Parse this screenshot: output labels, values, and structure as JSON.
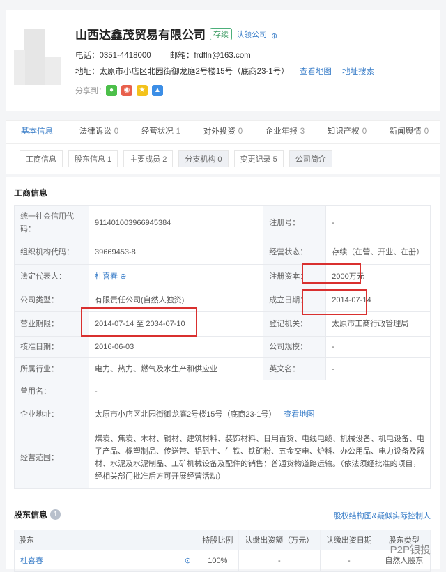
{
  "company": {
    "name": "山西达鑫茂贸易有限公司",
    "status": "存续",
    "claim": "认领公司",
    "phone": "电话：0351-4418000",
    "email": "邮箱：frdfln@163.com",
    "address": "地址：太原市小店区北园街御龙庭2号楼15号（底商23-1号）",
    "view_map": "查看地图",
    "addr_search": "地址搜索",
    "share_label": "分享到："
  },
  "tabs": [
    {
      "label": "基本信息",
      "count": ""
    },
    {
      "label": "法律诉讼",
      "count": "0"
    },
    {
      "label": "经营状况",
      "count": "1"
    },
    {
      "label": "对外投资",
      "count": "0"
    },
    {
      "label": "企业年报",
      "count": "3"
    },
    {
      "label": "知识产权",
      "count": "0"
    },
    {
      "label": "新闻舆情",
      "count": "0"
    }
  ],
  "subtabs": [
    "工商信息",
    "股东信息 1",
    "主要成员 2",
    "分支机构 0",
    "变更记录 5",
    "公司简介"
  ],
  "section_title": "工商信息",
  "info": {
    "credit_code_label": "统一社会信用代码：",
    "credit_code": "911401003966945384",
    "reg_no_label": "注册号：",
    "reg_no": "-",
    "org_code_label": "组织机构代码：",
    "org_code": "39669453-8",
    "biz_status_label": "经营状态：",
    "biz_status": "存续（在营、开业、在册）",
    "legal_rep_label": "法定代表人：",
    "legal_rep": "杜喜春",
    "reg_capital_label": "注册资本：",
    "reg_capital": "2000万元",
    "type_label": "公司类型：",
    "type": "有限责任公司(自然人独资)",
    "founded_label": "成立日期：",
    "founded": "2014-07-14",
    "term_label": "营业期限：",
    "term": "2014-07-14 至 2034-07-10",
    "authority_label": "登记机关：",
    "authority": "太原市工商行政管理局",
    "approved_label": "核准日期：",
    "approved": "2016-06-03",
    "scale_label": "公司规模：",
    "scale": "-",
    "industry_label": "所属行业：",
    "industry": "电力、热力、燃气及水生产和供应业",
    "en_name_label": "英文名：",
    "en_name": "-",
    "former_label": "曾用名：",
    "former": "-",
    "address_label": "企业地址：",
    "address": "太原市小店区北园街御龙庭2号楼15号（底商23-1号）",
    "view_map": "查看地图",
    "scope_label": "经营范围：",
    "scope": "煤炭、焦炭、木材、钢材、建筑材料、装饰材料、日用百货、电线电缆、机械设备、机电设备、电子产品、橡塑制品、传送带、铝矾土、生铁、铁矿粉、五金交电、炉料、办公用品、电力设备及器材、水泥及水泥制品、工矿机械设备及配件的销售；普通货物道路运输。（依法须经批准的项目，经相关部门批准后方可开展经营活动）"
  },
  "shareholders": {
    "title": "股东信息",
    "count": "1",
    "link": "股权结构图&疑似实际控制人",
    "headers": [
      "股东",
      "持股比例",
      "认缴出资额（万元）",
      "认缴出资日期",
      "股东类型"
    ],
    "rows": [
      {
        "name": "杜喜春",
        "ratio": "100%",
        "amount": "-",
        "date": "-",
        "type": "自然人股东"
      }
    ]
  },
  "watermark": "P2P银投"
}
